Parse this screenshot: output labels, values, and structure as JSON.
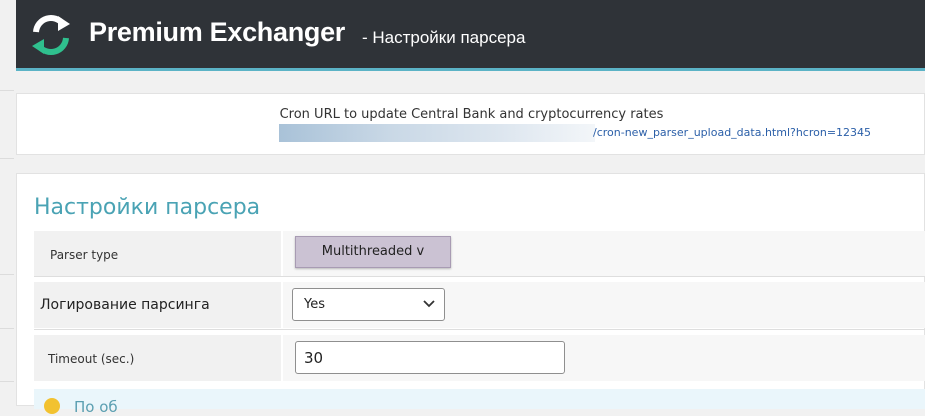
{
  "header": {
    "brand": "Premium Exchanger",
    "subtitle": "- Настройки парсера"
  },
  "cron": {
    "label": "Cron URL to update Central Bank and cryptocurrency rates",
    "url_suffix": "/cron-new_parser_upload_data.html?hcron=12345"
  },
  "panel": {
    "title": "Настройки парсера",
    "rows": [
      {
        "label": "Parser type",
        "button_label": "Multithreaded v"
      },
      {
        "label": "Логирование парсинга",
        "selected": "Yes"
      },
      {
        "label": "Timeout (sec.)",
        "value": "30"
      }
    ],
    "notice": {
      "text": "По об"
    }
  },
  "colors": {
    "header_bg": "#2f3338",
    "accent": "#5bb3c6",
    "title": "#4aa3b4",
    "link": "#2b5fa8",
    "button_bg": "#cbc2d3"
  },
  "icons": {
    "logo": "refresh-arrows-icon",
    "select_arrow": "chevron-down-icon",
    "notice": "lightbulb-icon"
  }
}
